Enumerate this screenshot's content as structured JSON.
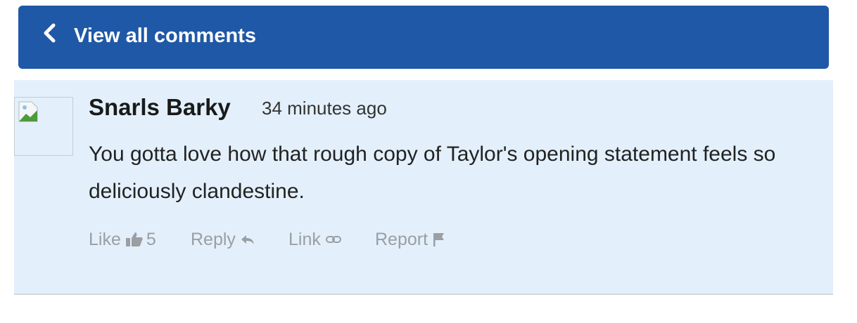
{
  "header": {
    "back_label": "View all comments",
    "back_icon": "chevron-left-icon",
    "background_color": "#1f58a6"
  },
  "comment": {
    "author": "Snarls Barky",
    "timestamp": "34 minutes ago",
    "body": "You gotta love how that rough copy of Taylor's opening statement feels so deliciously clandestine.",
    "avatar_icon": "broken-image-icon",
    "background_color": "#e3f0fc",
    "actions": {
      "like_label": "Like",
      "like_count": "5",
      "like_icon": "thumbs-up-icon",
      "reply_label": "Reply",
      "reply_icon": "reply-arrow-icon",
      "link_label": "Link",
      "link_icon": "chain-link-icon",
      "report_label": "Report",
      "report_icon": "flag-icon"
    }
  }
}
